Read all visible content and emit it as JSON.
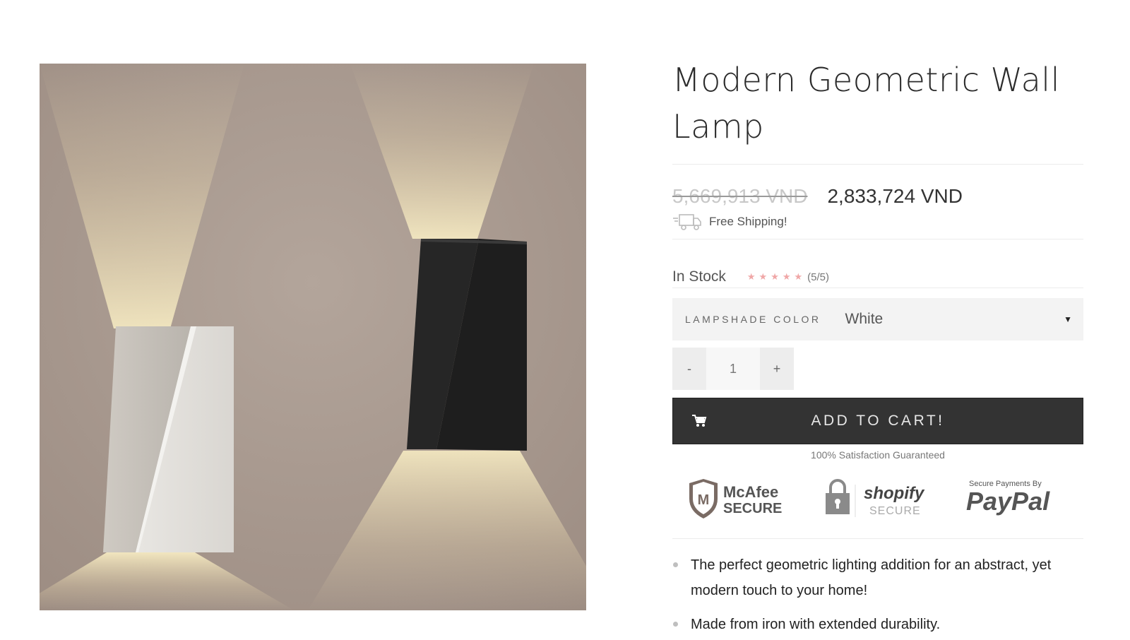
{
  "product": {
    "title": "Modern Geometric Wall Lamp",
    "old_price": "5,669,913 VND",
    "new_price": "2,833,724 VND",
    "shipping_text": "Free Shipping!",
    "stock_text": "In Stock",
    "rating": 5,
    "rating_text": "(5/5)",
    "variant_label": "LAMPSHADE COLOR",
    "variant_value": "White",
    "qty_minus": "-",
    "qty_value": "1",
    "qty_plus": "+",
    "cart_label": "ADD TO CART!",
    "guarantee_text": "100% Satisfaction Guaranteed",
    "badges": {
      "mcafee_line1": "McAfee",
      "mcafee_line2": "SECURE",
      "shopify_line1": "shopify",
      "shopify_line2": "SECURE",
      "paypal_small": "Secure Payments By",
      "paypal_brand": "PayPal"
    },
    "features": [
      "The perfect geometric lighting addition for an abstract, yet modern touch to your home!",
      "Made from iron with extended durability."
    ]
  },
  "icons": {
    "shipping": "truck-icon",
    "cart": "cart-icon",
    "star": "star-icon",
    "caret": "caret-down-icon"
  },
  "colors": {
    "cart_bg": "#333333",
    "star": "#f0a7a7",
    "variant_bg": "#f3f3f3"
  }
}
